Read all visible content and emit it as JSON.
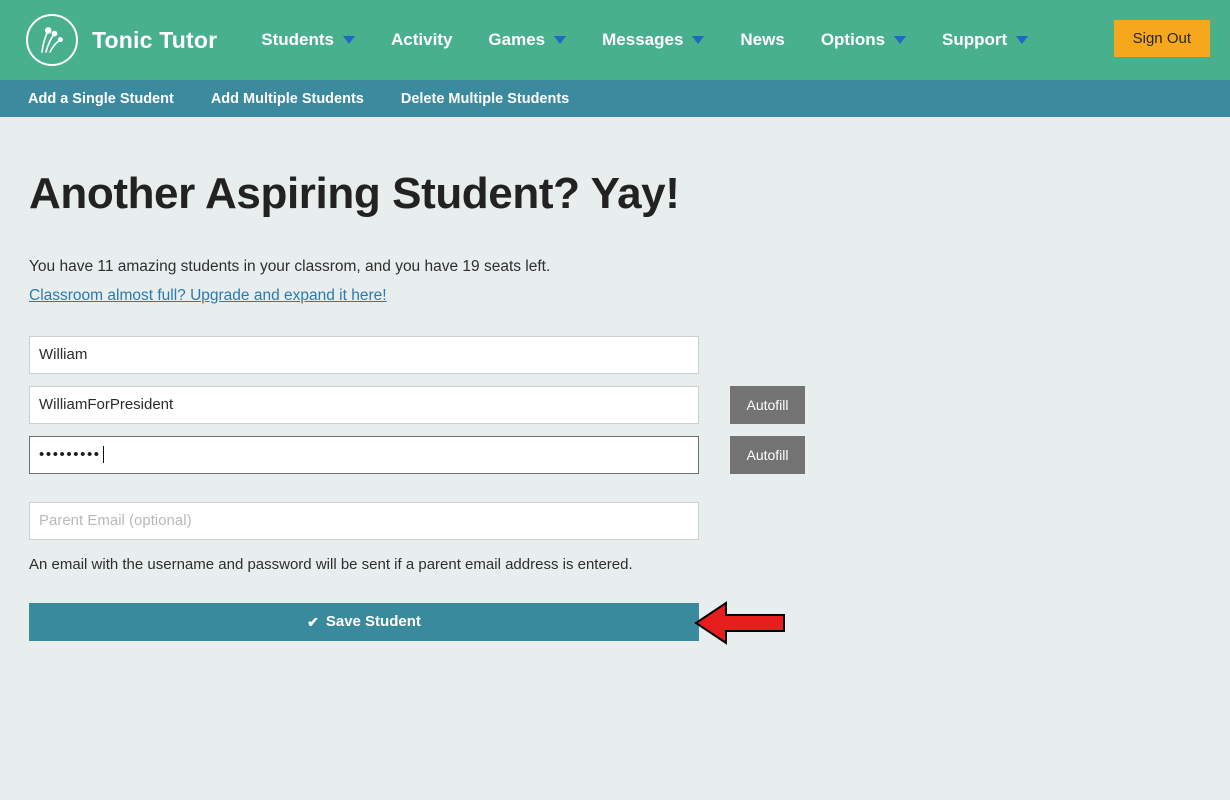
{
  "header": {
    "brand": "Tonic Tutor",
    "logo_icon": "tonic-tutor-sprout-notes-logo",
    "nav": [
      {
        "label": "Students",
        "has_caret": true,
        "icon": "chevron-down-icon"
      },
      {
        "label": "Activity",
        "has_caret": false,
        "icon": ""
      },
      {
        "label": "Games",
        "has_caret": true,
        "icon": "chevron-down-icon"
      },
      {
        "label": "Messages",
        "has_caret": true,
        "icon": "chevron-down-icon"
      },
      {
        "label": "News",
        "has_caret": false,
        "icon": ""
      },
      {
        "label": "Options",
        "has_caret": true,
        "icon": "chevron-down-icon"
      },
      {
        "label": "Support",
        "has_caret": true,
        "icon": "chevron-down-icon"
      }
    ],
    "sign_out_label": "Sign Out",
    "bg_color": "#48b08c",
    "sign_out_color": "#f5a81c",
    "caret_color": "#2167c4"
  },
  "subnav": {
    "bg_color": "#3b8a9e",
    "items": [
      {
        "label": "Add a Single Student"
      },
      {
        "label": "Add Multiple Students"
      },
      {
        "label": "Delete Multiple Students"
      }
    ]
  },
  "main": {
    "title": "Another Aspiring Student? Yay!",
    "seat_summary": "You have 11 amazing students in your classrom, and you have 19 seats left.",
    "student_count": "11",
    "seats_left": "19",
    "upgrade_link": "Classroom almost full? Upgrade and expand it here!",
    "help_text": "An email with the username and password will be sent if a parent email address is entered.",
    "background_color": "#e7eeed"
  },
  "form": {
    "name_field": {
      "value": "William",
      "placeholder": "Name"
    },
    "username_field": {
      "value": "WilliamForPresident",
      "placeholder": "Username",
      "autofill_label": "Autofill"
    },
    "password_field": {
      "value": "•••••••••",
      "placeholder": "Password",
      "autofill_label": "Autofill",
      "focused": "true"
    },
    "email_field": {
      "value": "",
      "placeholder": "Parent Email (optional)"
    },
    "save_button": {
      "label": "Save Student",
      "icon": "checkmark-icon",
      "glyph": "✔",
      "color": "#3a8a9e"
    },
    "autofill_color": "#737373"
  },
  "annotation": {
    "arrow_icon": "red-left-arrow-pointer",
    "fill_color": "#e81d1d",
    "stroke_color": "#000000",
    "points_at": "Save Student"
  }
}
